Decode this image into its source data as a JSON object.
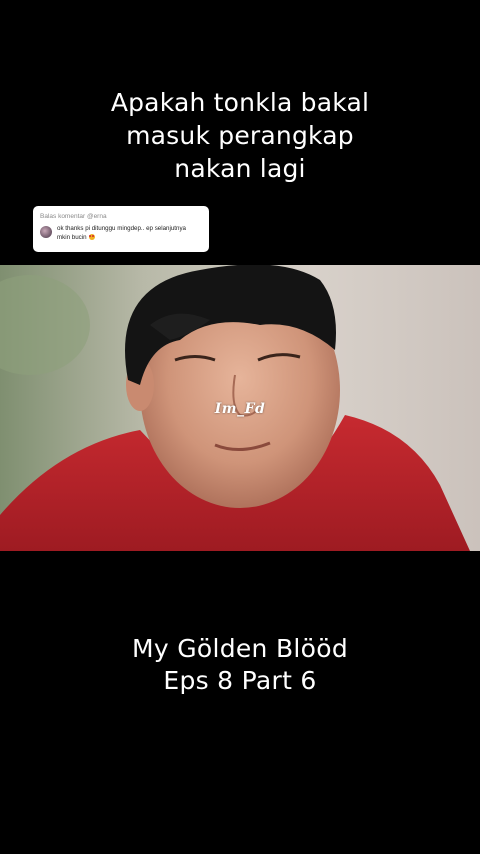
{
  "top_caption": {
    "line1": "Apakah tonkla bakal",
    "line2": "masuk perangkap",
    "line3": "nakan lagi"
  },
  "reply_card": {
    "title": "Balas komentar @erna",
    "line1": "ok thanks pi ditunggu mingdep.. ep selanjutnya",
    "line2": "mkin bucin",
    "emoji": "heart-eyes-emoji"
  },
  "video": {
    "watermark": "Im_Fd"
  },
  "bottom_caption": {
    "line1": "My Gölden Blööd",
    "line2": "Eps 8 Part 6"
  },
  "colors": {
    "background": "#000000",
    "text": "#ffffff",
    "card": "#ffffff",
    "shirt": "#c4262c"
  }
}
